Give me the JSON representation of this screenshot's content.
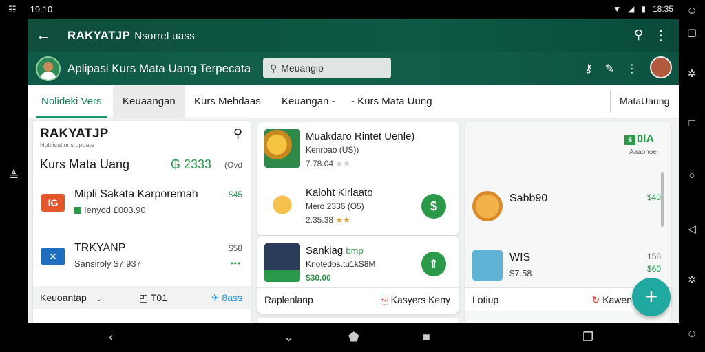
{
  "status": {
    "time": "19:10",
    "left_glyph": "☷",
    "right_time": "18:35"
  },
  "appbar": {
    "title": "RAKYATJP",
    "subtitle": "Nsorrel uass"
  },
  "subbar": {
    "heading": "Aplipasi Kurs Mata Uang Terpecata",
    "search_placeholder": "Meuangip"
  },
  "tabs": [
    {
      "label": "Nolideki Vers"
    },
    {
      "label": "Keuaangan"
    },
    {
      "label": "Kurs Mehdaas"
    },
    {
      "label": "Keuangan -"
    },
    {
      "label": "- Kurs Mata Uung"
    },
    {
      "label": "MataUaung"
    }
  ],
  "left": {
    "brand": "RAKYATJP",
    "brand_sub": "Notifications update",
    "rate_title": "Kurs Mata Uang",
    "rate_value": "₲ 2333",
    "rate_unit": "(Ovd",
    "rows": [
      {
        "logo": "IG",
        "name": "Mipli Sakata Karporemah",
        "meta": "Ienyod £003.90",
        "amount": "$45"
      },
      {
        "logo": "✕",
        "name": "TRKYANP",
        "meta": "Sansiroly $7.937",
        "amount": "$58",
        "dots": "•••"
      }
    ],
    "footer": {
      "left": "Keuoantap",
      "mid": "T01",
      "right": "8ass"
    }
  },
  "middle": {
    "cards": [
      {
        "name": "Muakdaro Rintet Uenle)",
        "meta": "Kenroao (US))",
        "sub": "7.78.04"
      },
      {
        "name": "Kaloht Kirlaato",
        "meta": "Mero 2336 (O5)",
        "sub": "2.35.38",
        "badge": "$"
      },
      {
        "name": "Sankiag",
        "name_accent": "bmp",
        "meta": "Knotedos.tu1kS8M",
        "sub": "$30.00"
      }
    ],
    "footer": {
      "left": "Raplenlanp",
      "right": "Kasyers Keny"
    }
  },
  "right": {
    "top_badge": "0lA",
    "top_sub": "Aaaonoe",
    "rows": [
      {
        "name": "Sabb90",
        "meta": "",
        "amount": "$40"
      },
      {
        "name": "WIS",
        "meta": "$7.58",
        "amount": "158",
        "amount2": "$60"
      }
    ],
    "footer": {
      "left": "Lotiup",
      "right": "Kawen"
    }
  },
  "colors": {
    "primary": "#0f4d3c",
    "accent": "#2a9a4a",
    "fab": "#1fa9a0"
  }
}
